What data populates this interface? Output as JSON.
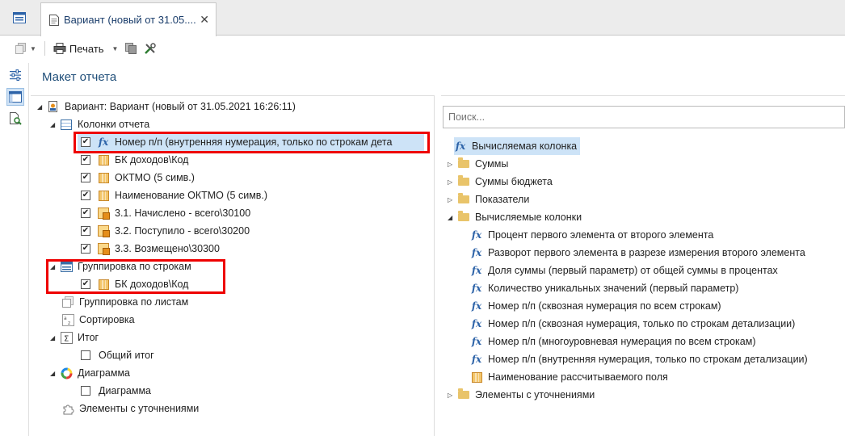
{
  "tab": {
    "title": "Вариант (новый от 31.05....",
    "close": "✕"
  },
  "toolbar": {
    "print_label": "Печать"
  },
  "heading": "Макет отчета",
  "tree": {
    "root": "Вариант: Вариант (новый от 31.05.2021 16:26:11)",
    "columns_header": "Колонки отчета",
    "columns": [
      "Номер п/п (внутренняя нумерация, только по строкам дета",
      "БК доходов\\Код",
      "ОКТМО (5 симв.)",
      "Наименование ОКТМО (5 симв.)",
      "3.1. Начислено - всего\\30100",
      "3.2. Поступило - всего\\30200",
      "3.3. Возмещено\\30300"
    ],
    "row_grouping": "Группировка по строкам",
    "row_grouping_item": "БК доходов\\Код",
    "sheet_grouping": "Группировка по листам",
    "sorting": "Сортировка",
    "total": "Итог",
    "total_item": "Общий итог",
    "chart": "Диаграмма",
    "chart_item": "Диаграмма",
    "refined": "Элементы с уточнениями"
  },
  "right": {
    "search_placeholder": "Поиск...",
    "calc_column": "Вычисляемая колонка",
    "sums": "Суммы",
    "budget_sums": "Суммы бюджета",
    "indicators": "Показатели",
    "calc_columns": "Вычисляемые колонки",
    "calc_items": [
      "Процент первого элемента от второго элемента",
      "Разворот первого элемента в разрезе измерения второго элемента",
      "Доля суммы (первый параметр) от общей суммы в процентах",
      "Количество уникальных значений (первый параметр)",
      "Номер п/п (сквозная нумерация по всем строкам)",
      "Номер п/п (сквозная нумерация, только по строкам детализации)",
      "Номер п/п (многоуровневая нумерация по всем строкам)",
      "Номер п/п (внутренняя нумерация, только по строкам детализации)"
    ],
    "calc_field_name": "Наименование рассчитываемого поля",
    "refined": "Элементы с уточнениями"
  },
  "colors": {
    "accent": "#1f4e79",
    "selection": "#cde3f7",
    "highlight": "#e00000",
    "fx": "#2d63a8"
  },
  "icons": [
    "app-menu-icon",
    "document-icon",
    "copy-icon",
    "print-icon",
    "copy-doc-icon",
    "tools-icon",
    "settings-icon",
    "layout-icon",
    "preview-icon",
    "fx-icon",
    "folder-icon",
    "table-icon",
    "checkbox-checked",
    "checkbox-empty"
  ]
}
